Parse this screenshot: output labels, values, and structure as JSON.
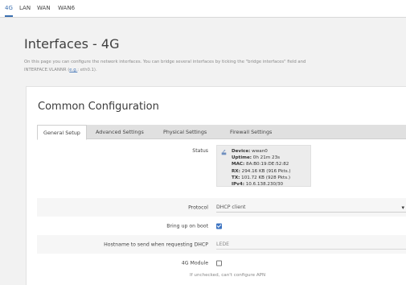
{
  "top_tabs": [
    {
      "label": "4G",
      "active": true
    },
    {
      "label": "LAN",
      "active": false
    },
    {
      "label": "WAN",
      "active": false
    },
    {
      "label": "WAN6",
      "active": false
    }
  ],
  "page": {
    "title": "Interfaces - 4G",
    "description_line1": "On this page you can configure the network interfaces. You can bridge several interfaces by ticking the \"bridge interfaces\" field and",
    "description_line2_prefix": "INTERFACE.VLANNR (",
    "description_line2_link": "e.g.",
    "description_line2_suffix": ": eth0.1)."
  },
  "section": {
    "title": "Common Configuration",
    "tabs": [
      {
        "label": "General Setup",
        "active": true
      },
      {
        "label": "Advanced Settings",
        "active": false
      },
      {
        "label": "Physical Settings",
        "active": false
      },
      {
        "label": "Firewall Settings",
        "active": false
      }
    ]
  },
  "status": {
    "label": "Status",
    "lines": [
      {
        "key": "Device:",
        "value": " wwan0"
      },
      {
        "key": "Uptime:",
        "value": " 0h 21m 23s"
      },
      {
        "key": "MAC:",
        "value": " 8A:B0:19:DE:52:82"
      },
      {
        "key": "RX:",
        "value": " 294.16 KB (916 Pkts.)"
      },
      {
        "key": "TX:",
        "value": " 101.72 KB (928 Pkts.)"
      },
      {
        "key": "IPv4:",
        "value": " 10.6.138.230/30"
      }
    ]
  },
  "protocol": {
    "label": "Protocol",
    "value": "DHCP client"
  },
  "boot": {
    "label": "Bring up on boot",
    "checked": true
  },
  "hostname": {
    "label": "Hostname to send when requesting DHCP",
    "value": "LEDE"
  },
  "module": {
    "label": "4G Module",
    "checked": false,
    "hint": "If unchecked, can't configure APN"
  },
  "colors": {
    "accent": "#3a6fb0",
    "checkbox": "#3d74c2"
  }
}
